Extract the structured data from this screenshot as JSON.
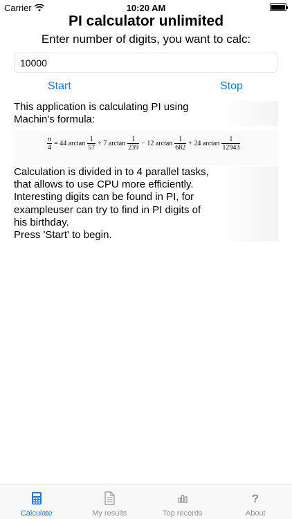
{
  "status": {
    "carrier": "Carrier",
    "time": "10:20 AM"
  },
  "header": {
    "title": "PI calculator unlimited",
    "prompt": "Enter number of digits, you want to calc:"
  },
  "digits_input": {
    "value": "10000"
  },
  "buttons": {
    "start": "Start",
    "stop": "Stop"
  },
  "description": {
    "intro": [
      "This application is calculating PI using",
      "Machin's formula:"
    ],
    "details": [
      "Calculation is divided in to 4 parallel tasks,",
      "that allows to use CPU more efficiently.",
      "Interesting digits can be found in PI, for",
      "exampleuser can try to find in PI digits of",
      "his birthday.",
      "Press 'Start' to begin."
    ]
  },
  "formula": {
    "lhs_num": "π",
    "lhs_den": "4",
    "eq": "= 44 arctan",
    "d1": "57",
    "t2": "+ 7 arctan",
    "d2": "239",
    "t3": "− 12 arctan",
    "d3": "682",
    "t4": "+ 24 arctan",
    "d4": "12943",
    "one": "1"
  },
  "tabs": [
    {
      "label": "Calculate",
      "icon": "calculator-icon",
      "active": true
    },
    {
      "label": "My results",
      "icon": "document-icon",
      "active": false
    },
    {
      "label": "Top records",
      "icon": "bar-chart-icon",
      "active": false
    },
    {
      "label": "About",
      "icon": "question-icon",
      "active": false
    }
  ],
  "colors": {
    "accent": "#1a7adf",
    "tab_inactive": "#929292"
  }
}
